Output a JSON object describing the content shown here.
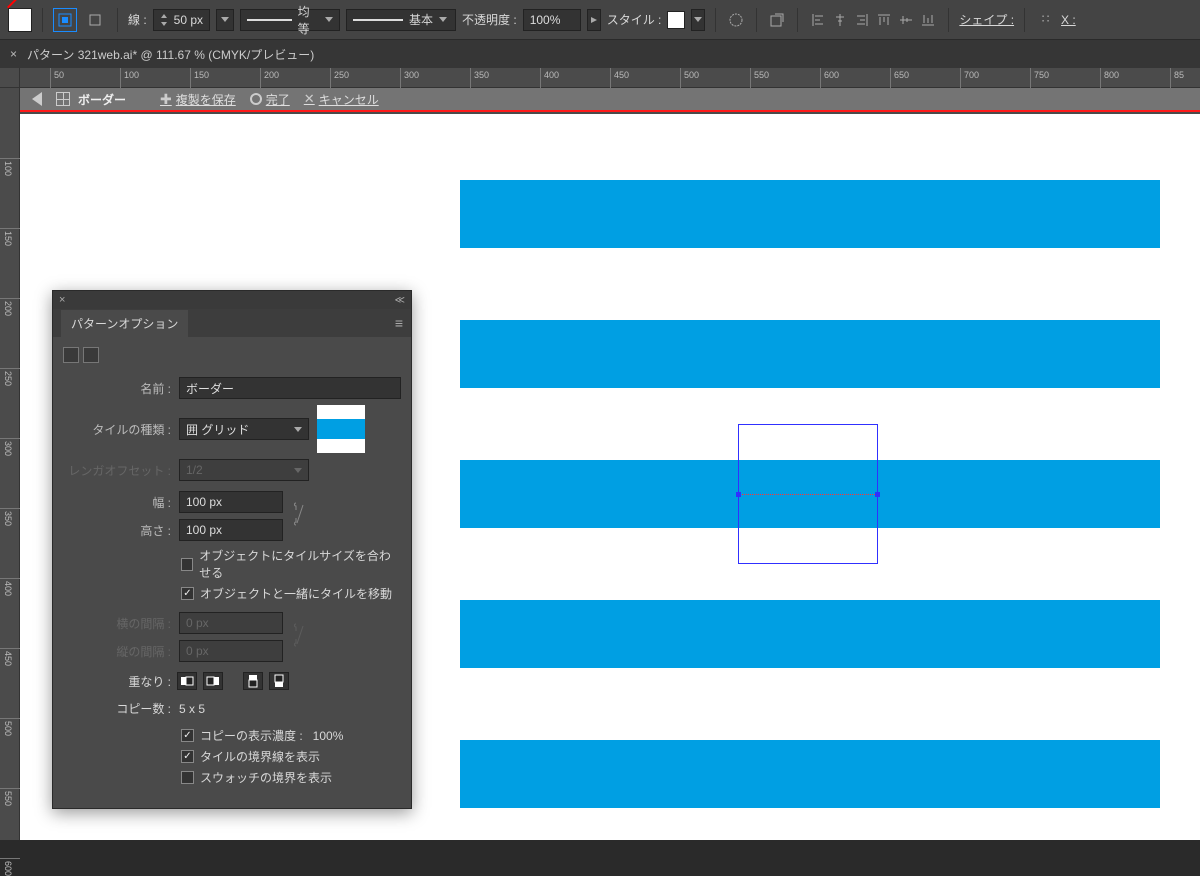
{
  "optbar": {
    "stroke_label": "線 :",
    "stroke_weight": "50 px",
    "profile_label": "均等",
    "brush_label": "基本",
    "opacity_label": "不透明度 :",
    "opacity_value": "100%",
    "style_label": "スタイル :",
    "shape_label": "シェイプ :",
    "transform_label": "X :"
  },
  "tab": {
    "close": "×",
    "title": "パターン 321web.ai* @ 111.67 % (CMYK/プレビュー)"
  },
  "ruler_h": [
    "50",
    "100",
    "150",
    "200",
    "250",
    "300",
    "350",
    "400",
    "450",
    "500",
    "550",
    "600",
    "650",
    "700",
    "750",
    "800",
    "85"
  ],
  "ruler_v": [
    "100",
    "150",
    "200",
    "250",
    "300",
    "350",
    "400",
    "450",
    "500",
    "550",
    "600"
  ],
  "editbar": {
    "title": "ボーダー",
    "save_copy": "複製を保存",
    "done": "完了",
    "cancel": "キャンセル"
  },
  "panel": {
    "title": "パターンオプション",
    "name_label": "名前 :",
    "name_value": "ボーダー",
    "tiletype_label": "タイルの種類 :",
    "tiletype_value": "囲 グリッド",
    "brick_label": "レンガオフセット :",
    "brick_value": "1/2",
    "width_label": "幅 :",
    "width_value": "100 px",
    "height_label": "高さ :",
    "height_value": "100 px",
    "size_to_art": "オブジェクトにタイルサイズを合わせる",
    "move_with_art": "オブジェクトと一緒にタイルを移動",
    "hspacing_label": "横の間隔 :",
    "vspacing_label": "縦の間隔 :",
    "spacing_value": "0 px",
    "overlap_label": "重なり :",
    "copies_label": "コピー数 :",
    "copies_value": "5 x 5",
    "dim_label": "コピーの表示濃度 :",
    "dim_value": "100%",
    "show_tile_edge": "タイルの境界線を表示",
    "show_swatch_bounds": "スウォッチの境界を表示"
  },
  "colors": {
    "stripe": "#009fe3"
  }
}
